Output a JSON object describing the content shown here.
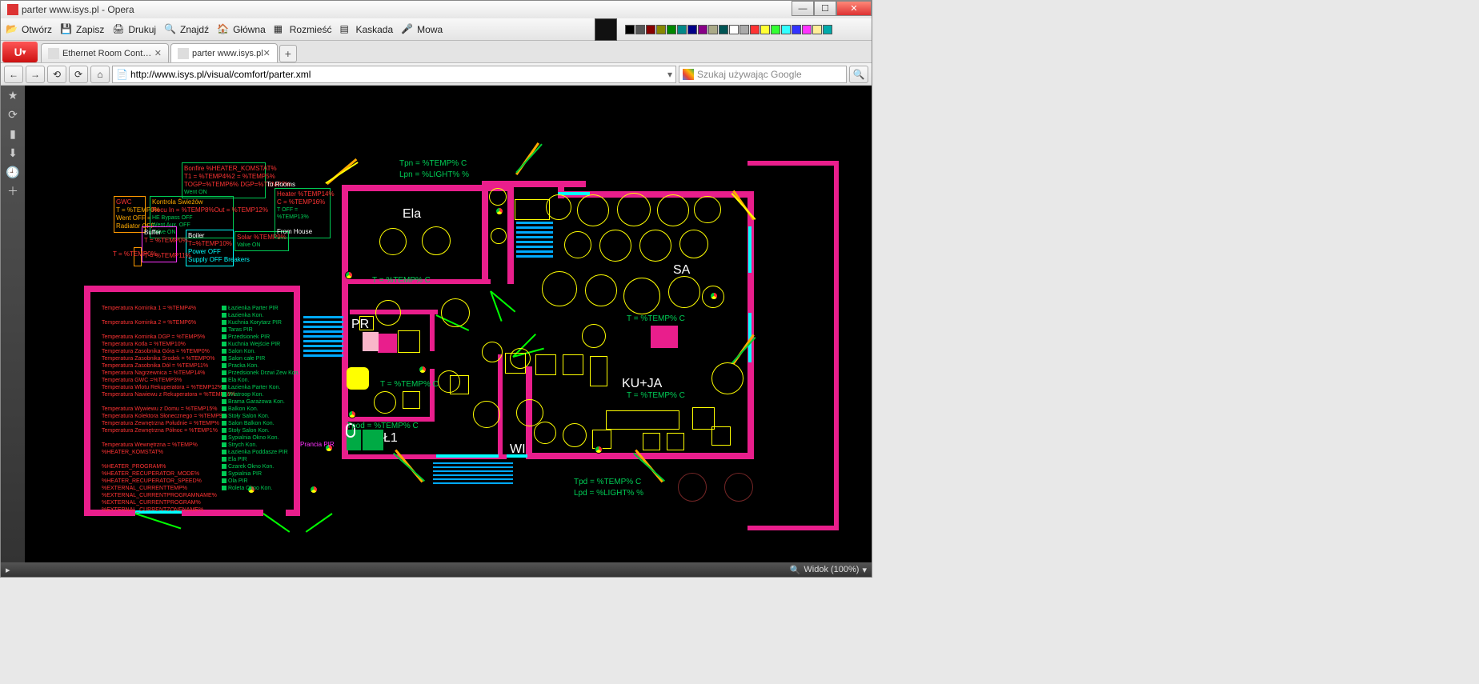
{
  "window": {
    "title": "parter www.isys.pl - Opera"
  },
  "menubar": {
    "otworz": "Otwórz",
    "zapisz": "Zapisz",
    "drukuj": "Drukuj",
    "znajdz": "Znajdź",
    "glowna": "Główna",
    "rozmiesc": "Rozmieść",
    "kaskada": "Kaskada",
    "mowa": "Mowa"
  },
  "tabs": {
    "t1": "Ethernet Room Control...",
    "t2": "parter www.isys.pl"
  },
  "address": {
    "url": "http://www.isys.pl/visual/comfort/parter.xml",
    "search_placeholder": "Szukaj używając Google"
  },
  "statusbar": {
    "widok": "Widok (100%)"
  },
  "rooms": {
    "ela": "Ela",
    "sa": "SA",
    "pr": "PR",
    "kuja": "KU+JA",
    "wi": "WI",
    "l1": "Ł1"
  },
  "sensors": {
    "tpn": "Tpn = %TEMP% C",
    "lpn": "Lpn = %LIGHT% %",
    "t_ela": "T = %TEMP% C",
    "t_sa": "T = %TEMP% C",
    "t_kuja": "T = %TEMP% C",
    "t_pr": "T = %TEMP% C",
    "tpod": "Tpod = %TEMP% C",
    "tpd": "Tpd = %TEMP% C",
    "lpd": "Lpd = %LIGHT% %",
    "prancia": "Prancia PIR"
  },
  "info_boxes": {
    "bonfire": {
      "title": "Bonfire %HEATER_KOMSTAT%",
      "lines": [
        "T1 = %TEMP4%2   = %TEMP5%",
        "TOGP=%TEMP6%  DGP=%TEMP7%",
        "Went ON",
        "",
        "To Rooms"
      ]
    },
    "heater": {
      "title": "Heater %TEMP14%",
      "lines": [
        "C = %TEMP16%",
        "T OFF = %TEMP13%",
        "",
        "From House"
      ]
    },
    "boiler": {
      "title": "Boiler",
      "lines": [
        "T=%TEMP10%",
        "Power OFF",
        "Supply OFF  Breakers"
      ]
    },
    "solar": {
      "title": "Solar %TEMP9%",
      "lines": [
        "Valve ON"
      ]
    },
    "buffer": {
      "title": "Buffer",
      "lines": [
        "T = %TEMP0%",
        "",
        "T = %TEMP11%"
      ]
    },
    "recu": {
      "title": "Kontrola Świeżów",
      "lines": [
        "Recu In = %TEMP8%Out = %TEMP12%",
        "HE Bypass OFF",
        "Went Aux. OFF",
        "Valve ON"
      ]
    },
    "gwc": {
      "title": "GWC",
      "lines": [
        "T = %TEMP0%",
        "Went OFF =",
        "Radiator OFF"
      ]
    },
    "left_small": {
      "lines": [
        "T = %TEMP0%"
      ]
    }
  },
  "red_list": [
    "Temperatura Kominka 1 = %TEMP4%",
    "",
    "Temperatura Kominka 2 = %TEMP6%",
    "",
    "Temperatura Kominka DGP = %TEMP5%",
    "Temperatura Kotla = %TEMP10%",
    "Temperatura Zasobnika Góra = %TEMP0%",
    "Temperatura Zasobnika Środek = %TEMP0%",
    "Temperatura Zasobnika Dół = %TEMP11%",
    "Temperatura Nagrzewnica = %TEMP14%",
    "Temperatura GWC =%TEMP3%",
    "Temperatura Wlotu Rekuperatora = %TEMP12%",
    "Temperatura Nawiewu z Rekuperatora = %TEMP18%",
    "",
    "Temperatura Wywiewu z Domu = %TEMP15%",
    "Temperatura Kolektora Słonecznego = %TEMP9%",
    "Temperatura Zewnętrzna Południe = %TEMP%",
    "Temperatura Zewnętrzna Północ = %TEMP1%",
    "",
    "Temperatura Wewnętrzna = %TEMP%",
    "%HEATER_KOMSTAT%",
    "",
    "%HEATER_PROGRAM%",
    "%HEATER_RECUPERATOR_MODE%",
    "%HEATER_RECUPERATOR_SPEED%",
    "%EXTERNAL_CURRENTTEMP%",
    "%EXTERNAL_CURRENTPROGRAMNAME%",
    "%EXTERNAL_CURRENTPROGRAM%",
    "%EXTERNAL_CURRENTZONENAME%"
  ],
  "green_list": [
    "Łazienka Parter PIR",
    "Łazienka Kon.",
    "Kuchnia Korytarz PIR",
    "Taras PIR",
    "Przedsionek PIR",
    "Kuchnia Wejście PIR",
    "Salon Kon.",
    "Salon całe PIR",
    "Pracka Kon.",
    "Przedsionek Drzwi Zew Kon.",
    "Ela Kon.",
    "Łazienka Parter Kon.",
    "Wiatroop Kon.",
    "Brama Garażowa Kon.",
    "Balkon Kon.",
    "Stoły Salon Kon.",
    "Salon Balkon Kon.",
    "Stoły Salon Kon.",
    "Sypialnia Okno Kon.",
    "Strych Kon.",
    "Łazienka Poddasze PIR",
    "Ela PIR",
    "Czarek Okno Kon.",
    "Sypialnia PIR",
    "Ola PIR",
    "Roleta Okno Kon."
  ]
}
